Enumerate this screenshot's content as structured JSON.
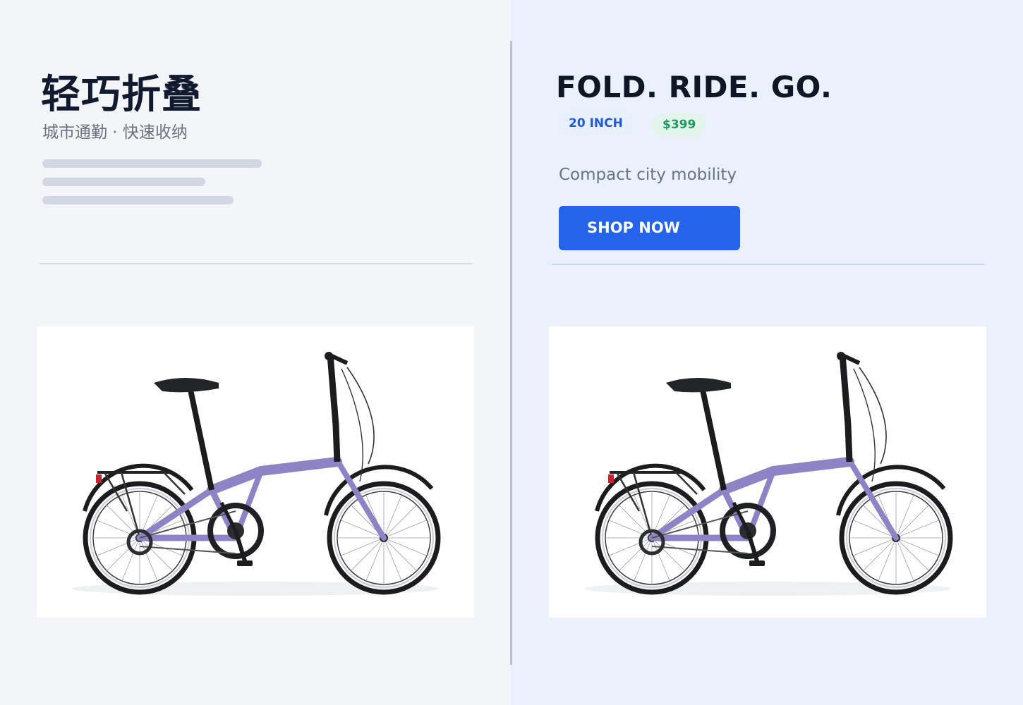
{
  "left": {
    "title": "轻巧折叠",
    "subtitle": "城市通勤 · 快速收纳",
    "image": {
      "icon": "folding-bike-photo"
    }
  },
  "right": {
    "title": "FOLD. RIDE. GO.",
    "badges": {
      "size": "20 INCH",
      "price": "$399"
    },
    "tagline": "Compact city mobility",
    "cta_label": "SHOP NOW",
    "image": {
      "icon": "folding-bike-photo"
    }
  },
  "colors": {
    "accent": "#2563eb",
    "frame": "#8e83c4",
    "price": "#1f9a62",
    "size_badge": "#2459d6"
  }
}
